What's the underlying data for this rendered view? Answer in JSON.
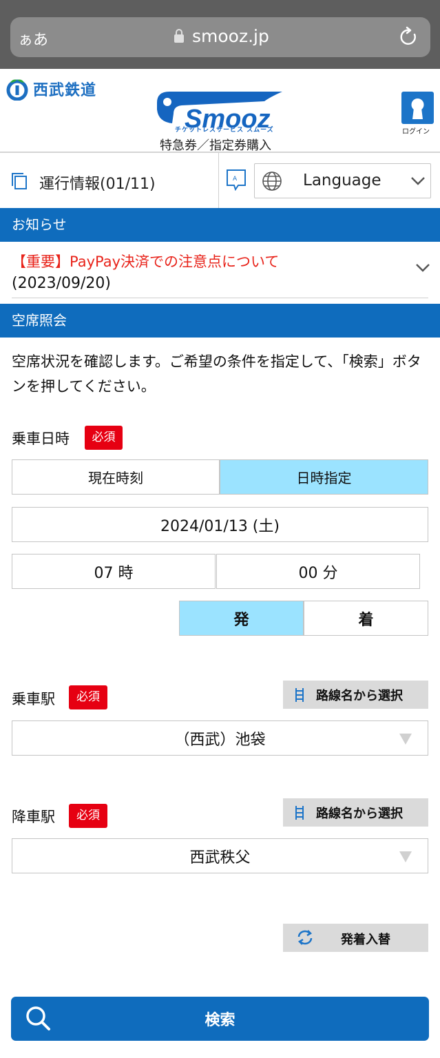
{
  "browser": {
    "aa_label": "ぁあ",
    "url": "smooz.jp"
  },
  "header": {
    "seibu_logo_text": "西武鉄道",
    "smooz_logo_text": "Smooz",
    "smooz_sub": "チケットレスサービス スムーズ",
    "title": "特急券／指定券購入",
    "login_label": "ログイン"
  },
  "info": {
    "operation_info": "運行情報(01/11)",
    "language_label": "Language"
  },
  "notices": {
    "section_title": "お知らせ",
    "items": [
      {
        "title": "【重要】PayPay決済での注意点について",
        "date": "(2023/09/20)"
      }
    ]
  },
  "availability": {
    "section_title": "空席照会",
    "description": "空席状況を確認します。ご希望の条件を指定して、「検索」ボタンを押してください。",
    "required_badge": "必須",
    "datetime": {
      "label": "乗車日時",
      "mode_now": "現在時刻",
      "mode_specify": "日時指定",
      "date": "2024/01/13 (土)",
      "hour": "07 時",
      "minute": "00 分",
      "depart": "発",
      "arrive": "着"
    },
    "boarding": {
      "label": "乗車駅",
      "route_button": "路線名から選択",
      "station": "（西武）池袋"
    },
    "alighting": {
      "label": "降車駅",
      "route_button": "路線名から選択",
      "station": "西武秩父"
    },
    "swap_button": "発着入替",
    "search_button": "検索"
  },
  "colors": {
    "brand_blue": "#0f6cbd",
    "active_segment": "#9be3ff",
    "required_red": "#e60012",
    "notice_red": "#e8231a"
  }
}
